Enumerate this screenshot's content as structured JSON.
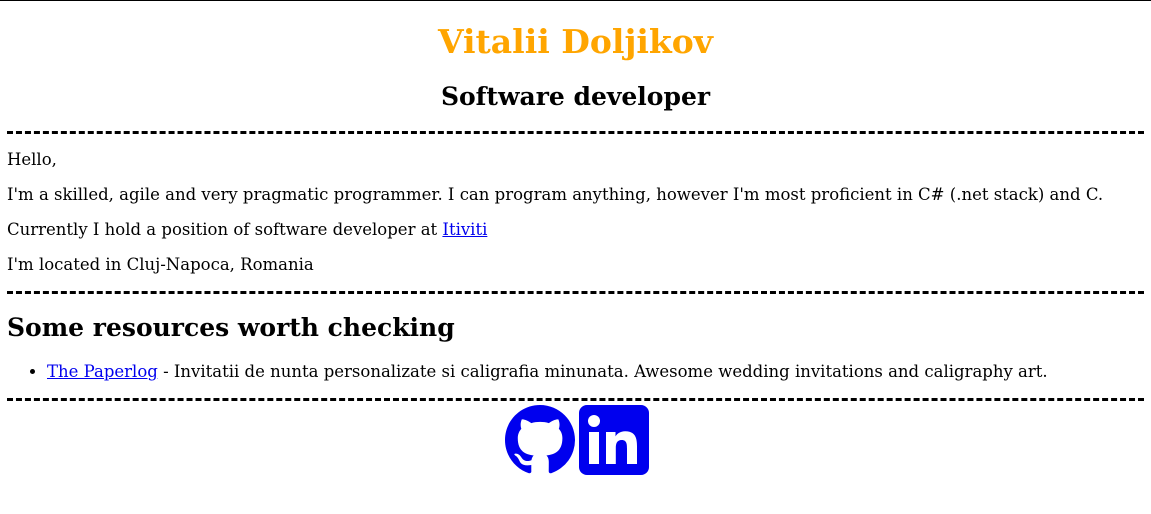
{
  "header": {
    "name": "Vitalii Doljikov",
    "role": "Software developer"
  },
  "about": {
    "greeting": "Hello,",
    "skills": "I'm a skilled, agile and very pragmatic programmer. I can program anything, however I'm most proficient in C# (.net stack) and C.",
    "position_prefix": "Currently I hold a position of software developer at ",
    "company_link": "Itiviti",
    "location": "I'm located in Cluj-Napoca, Romania"
  },
  "resources": {
    "title": "Some resources worth checking",
    "items": [
      {
        "link_text": "The Paperlog",
        "description": " - Invitatii de nunta personalizate si caligrafia minunata. Awesome wedding invitations and caligraphy art."
      }
    ]
  },
  "social": {
    "icons": [
      "github-icon",
      "linkedin-icon"
    ],
    "icon_color": "#0000ee"
  },
  "colors": {
    "name_color": "#ffa500",
    "link_color": "#0000ee"
  }
}
